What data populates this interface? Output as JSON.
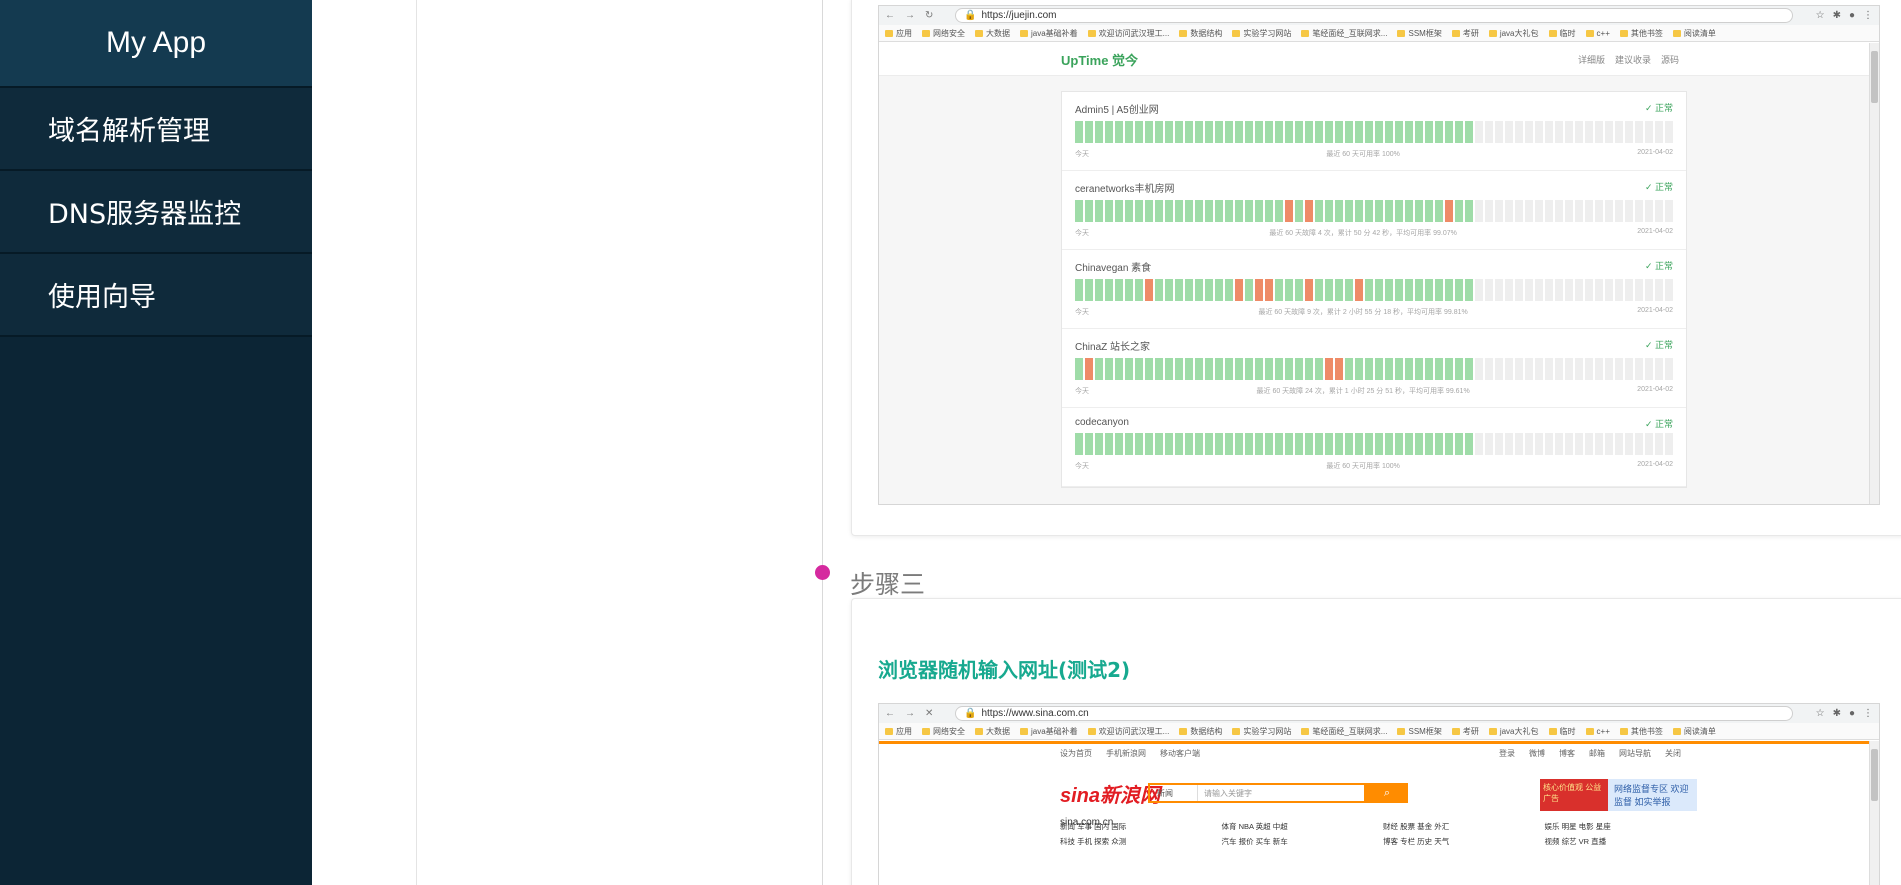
{
  "sidebar": {
    "brand": "My App",
    "items": [
      {
        "label": "域名解析管理"
      },
      {
        "label": "DNS服务器监控"
      },
      {
        "label": "使用向导"
      }
    ]
  },
  "step3": {
    "title": "步骤三",
    "card_title": "浏览器随机输入网址(测试2)"
  },
  "browser1": {
    "url": "https://juejin.com",
    "bookmarks": [
      "应用",
      "网络安全",
      "大数据",
      "java基础补着",
      "欢迎访问武汉理工...",
      "数据结构",
      "实验学习网站",
      "笔经面经_互联网求...",
      "SSM框架",
      "考研",
      "java大礼包",
      "临时",
      "c++",
      "其他书签",
      "阅读清单"
    ],
    "uptime": {
      "logo": "UpTime 觉今",
      "nav": [
        "详细版",
        "建议收录",
        "源码"
      ],
      "monitors": [
        {
          "name": "Admin5 | A5创业网",
          "status": "正常",
          "left": "今天",
          "summary": "最近 60 天可用率 100%",
          "date": "2021-04-02",
          "pattern": "gggggggggggggggggggggggggggggggggggggggg"
        },
        {
          "name": "ceranetworks丰机房网",
          "status": "正常",
          "left": "今天",
          "summary": "最近 60 天故障 4 次，累计 50 分 42 秒，平均可用率 99.07%",
          "date": "2021-04-02",
          "pattern": "gggggggggggggggggggggrgrgggggggggggggrgg"
        },
        {
          "name": "Chinavegan 素食",
          "status": "正常",
          "left": "今天",
          "summary": "最近 60 天故障 9 次，累计 2 小时 55 分 18 秒，平均可用率 99.81%",
          "date": "2021-04-02",
          "pattern": "gggggggrggggggggrgrrgggrggggrggggggggggg"
        },
        {
          "name": "ChinaZ 站长之家",
          "status": "正常",
          "left": "今天",
          "summary": "最近 60 天故障 24 次，累计 1 小时 25 分 51 秒，平均可用率 99.61%",
          "date": "2021-04-02",
          "pattern": "grgggggggggggggggggggggggrrggggggggggggg"
        },
        {
          "name": "codecanyon",
          "status": "正常",
          "left": "今天",
          "summary": "最近 60 天可用率 100%",
          "date": "2021-04-02",
          "pattern": "gggggggggggggggggggggggggggggggggggggggg"
        }
      ]
    }
  },
  "browser2": {
    "url": "https://www.sina.com.cn",
    "top_links": [
      "设为首页",
      "手机新浪网",
      "移动客户端"
    ],
    "top_right": [
      "登录",
      "微博",
      "博客",
      "邮箱",
      "网站导航",
      "关闭"
    ],
    "logo": "sina新浪网",
    "logo_sub": "sina.com.cn",
    "search_cat": "新闻",
    "search_placeholder": "请输入关键字",
    "banner_left": "核心价值观 公益广告",
    "banner_right": "网络监督专区 欢迎监督 如实举报",
    "links": [
      "新闻 军事 国内 国际",
      "体育 NBA 英超 中超",
      "财经 股票 基金 外汇",
      "娱乐 明星 电影 星座",
      "科技 手机 探索 众测",
      "汽车 报价 买车 新车",
      "博客 专栏 历史 天气",
      "视频 综艺 VR 直播"
    ]
  }
}
